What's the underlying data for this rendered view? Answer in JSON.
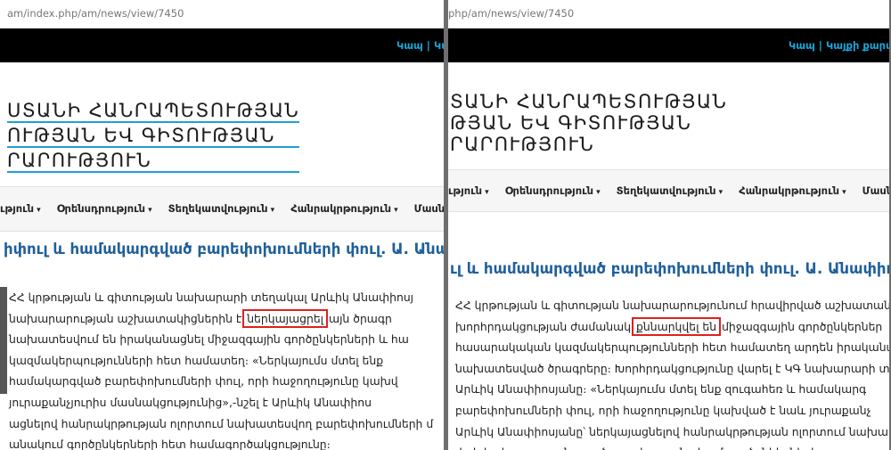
{
  "left": {
    "url": "am/index.php/am/news/view/7450",
    "top_links": "Կապ | Կայ",
    "title_lines": [
      "ՍՏԱՆԻ ՀԱՆՐԱՊԵՏՈՒԹՅԱՆ",
      "ՈՒԹՅԱՆ ԵՎ ԳԻՏՈՒԹՅԱՆ",
      "ՐԱՐՈՒԹՅՈՒՆ"
    ],
    "menu": [
      "ւթյուն",
      "Օրենսդրություն",
      "Տեղեկատվություն",
      "Հանրակրթություն",
      "Մասնագիտակ"
    ],
    "headline": "իփուլ և համակարգված բարեփոխումների փուլ. Ա. Անափիոսյա",
    "article_lines": [
      "ՀՀ կրթության և գիտության նախարարի տեղակալ Արևիկ Անափիոսյ",
      "նախարարության աշխատակիցներին է",
      "այն ծրագր",
      "նախատեսվում են իրականացնել միջազգային գործընկերների և հա",
      "կազմակերպությունների հետ համատեղ։ «Ներկայումս մտել ենք",
      "համակարգված բարեփոխումների փուլ, որի հաջողությունը կախվ",
      "յուրաքանչյուրիս մասնակցությունից»,-նշել է Արևիկ Անափիոս",
      "ացնելով հանրակրթության ոլորտում նախատեսվող բարեփոխումների մ",
      "անակում գործընկերների հետ համագործակցությունը։"
    ],
    "highlight": "ներկայացրել"
  },
  "right": {
    "url": "php/am/news/view/7450",
    "top_links": "Կապ | Կայքի քարտ",
    "title_lines": [
      "ՏԱՆԻ ՀԱՆՐԱՊԵՏՈՒԹՅԱՆ",
      "ԹՅԱՆ ԵՎ ԳԻՏՈՒԹՅԱՆ",
      "ՐԱՐՈՒԹՅՈՒՆ"
    ],
    "menu": [
      "ւթյուն",
      "Օրենսդրություն",
      "Տեղեկատվություն",
      "Հանրակրթություն",
      "Մասնագիտակ"
    ],
    "headline": "ւլ և համակարգված բարեփոխումների փուլ. Ա. Անափիոսյա",
    "article_lines": [
      "ՀՀ կրթության և գիտության նախարարությունում հրավիրված աշխատանքա",
      "խորհրդակցության ժամանակ",
      "միջազգային գործընկերներ",
      "հասարակական կազմակերպությունների հետ համատեղ արդեն իրականացվ",
      "նախատեսված ծրագրերը։ Խորհրդակցությունը վարել է ԿԳ նախարարի տեղա",
      "Արևիկ Անափիոսյանը։ «Ներկայումս մտել ենք զուգահեռ և համակարգ",
      "բարեփոխումների փուլ, որի հաջողությունը կախված է նաև յուրաքանչ",
      "Արևիկ Անափիոսյանը՝ ներկայացնելով հանրակրթության ոլորտում նախատես",
      "փոխեր և յուրաքանչյուր ծրագրի շրջանակում գործընկերների"
    ],
    "highlight": "քննարկվել են"
  }
}
